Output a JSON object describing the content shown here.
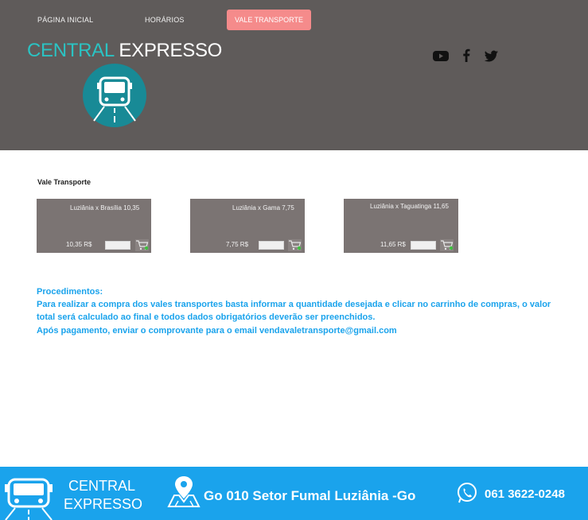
{
  "nav": {
    "items": [
      {
        "label": "PÁGINA INICIAL"
      },
      {
        "label": "HORÁRIOS"
      },
      {
        "label": "VALE TRANSPORTE"
      }
    ]
  },
  "logo": {
    "central": "CENTRAL",
    "expresso": "EXPRESSO"
  },
  "social": [
    "youtube-icon",
    "facebook-icon",
    "twitter-icon"
  ],
  "section": {
    "title": "Vale Transporte"
  },
  "products": [
    {
      "title": "Luziânia x Brasília 10,35",
      "price": "10,35 R$",
      "qty": ""
    },
    {
      "title": "Luziânia x Gama 7,75",
      "price": "7,75 R$",
      "qty": ""
    },
    {
      "title": "Luziânia x Taguatinga 11,65",
      "price": "11,65 R$",
      "qty": ""
    }
  ],
  "procedures": {
    "title": "Procedimentos:",
    "line1": "Para realizar a compra dos vales transportes basta  informar a quantidade desejada e clicar no carrinho de compras, o valor",
    "line2": "total será calculado ao final e todos dados obrigatórios deverão ser preenchidos.",
    "line3": "Após pagamento, enviar o comprovante para o email vendavaletransporte@gmail.com"
  },
  "footer": {
    "brand_1": "CENTRAL",
    "brand_2": "EXPRESSO",
    "address": "Go 010 Setor Fumal Luziânia -Go",
    "phone": "061 3622-0248"
  },
  "colors": {
    "header_bg": "#5f5b5a",
    "accent_teal": "#2bc3c3",
    "nav_active": "#f58b8b",
    "card_bg": "#7b7473",
    "procedures_text": "#1aa3ec",
    "footer_bg": "#1aa3ec"
  }
}
